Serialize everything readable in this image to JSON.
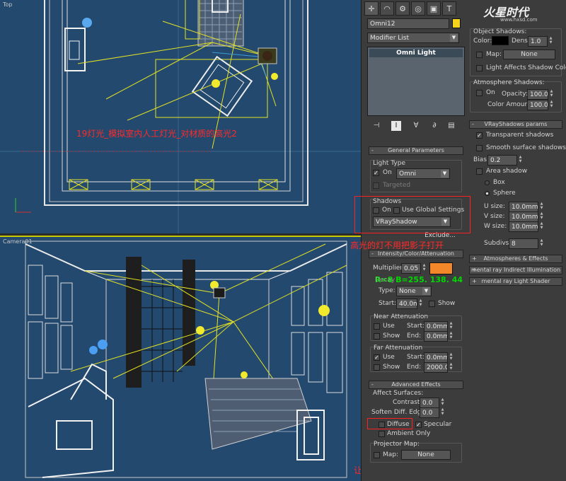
{
  "viewports": {
    "top_label": "Top",
    "camera_label": "Camera01",
    "top_annotation": "19灯光_模拟室内人工灯光_对材质的高光2",
    "shadow_annotation": "高光的灯不用把影子打开",
    "color_annotation": "R=8 B=255. 138. 44",
    "diffuse_annotation": "让灯光不对物体的过度色产生光照"
  },
  "panel": {
    "tabs": [
      "✛",
      "◠",
      "⚙",
      "◎",
      "▣",
      "T"
    ],
    "logo": "火星时代",
    "logo_sub": "www.hxsd.com",
    "object_name": "Omni12",
    "object_color": "#f6d41c",
    "modifier_list": "Modifier List",
    "stack_item": "Omni Light",
    "tools": [
      "⊣",
      "I",
      "∀",
      "∂",
      "▤"
    ],
    "general": {
      "title": "General Parameters",
      "light_type_label": "Light Type",
      "on_label": "On",
      "light_type": "Omni",
      "targeted_label": "Targeted",
      "shadows_label": "Shadows",
      "shadows_on_label": "On",
      "use_global_label": "Use Global Settings",
      "shadow_type": "VRayShadow",
      "exclude_label": "Exclude..."
    },
    "intensity": {
      "title": "Intensity/Color/Attenuation",
      "multiplier_label": "Multiplier:",
      "multiplier": "0.05",
      "color": "#f5872b",
      "decay_label": "Decay",
      "type_label": "Type:",
      "type_value": "None",
      "start_label": "Start:",
      "start_value": "40.0mm",
      "show_label": "Show",
      "near_label": "Near Attenuation",
      "use_label": "Use",
      "near_start": "0.0mm",
      "end_label": "End:",
      "near_end": "0.0mm",
      "far_label": "Far Attenuation",
      "far_start": "0.0mm",
      "far_end": "2000.0mm"
    },
    "advanced": {
      "title": "Advanced Effects",
      "affect_label": "Affect Surfaces:",
      "contrast_label": "Contrast:",
      "contrast": "0.0",
      "soften_label": "Soften Diff. Edge:",
      "soften": "0.0",
      "diffuse_label": "Diffuse",
      "specular_label": "Specular",
      "ambient_label": "Ambient Only",
      "projector_label": "Projector Map:",
      "map_label": "Map:",
      "map_value": "None"
    },
    "object_shadows": {
      "title": "Object Shadows:",
      "color_label": "Color:",
      "dens_label": "Dens.",
      "dens": "1.0",
      "map_label": "Map:",
      "map_value": "None",
      "light_affects_label": "Light Affects Shadow Color",
      "atmos_label": "Atmosphere Shadows:",
      "on_label": "On",
      "opacity_label": "Opacity:",
      "opacity": "100.0",
      "color_amount_label": "Color Amount:",
      "color_amount": "100.0"
    },
    "vray": {
      "title": "VRayShadows params",
      "transparent_label": "Transparent shadows",
      "smooth_label": "Smooth surface shadows",
      "bias_label": "Bias:",
      "bias": "0.2",
      "area_label": "Area shadow",
      "box_label": "Box",
      "sphere_label": "Sphere",
      "usize_label": "U size:",
      "usize": "10.0mm",
      "vsize_label": "V size:",
      "vsize": "10.0mm",
      "wsize_label": "W size:",
      "wsize": "10.0mm",
      "subdivs_label": "Subdivs:",
      "subdivs": "8"
    },
    "collapsed": [
      "Atmospheres & Effects",
      "mental ray Indirect Illumination",
      "mental ray Light Shader"
    ]
  }
}
